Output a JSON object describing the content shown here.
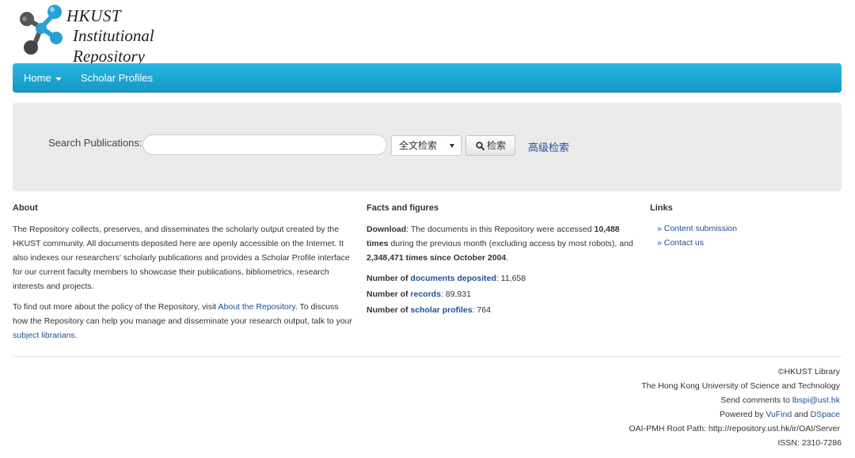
{
  "logo": {
    "line1": "HKUST",
    "line2": "Institutional Repository",
    "colors": {
      "dark": "#444444",
      "blue": "#2a9fd6"
    }
  },
  "nav": {
    "home_label": "Home",
    "scholar_label": "Scholar Profiles",
    "accent": "#1ea5d4"
  },
  "search": {
    "label": "Search Publications:",
    "input_value": "",
    "select_value": "全文检索",
    "button_label": "检索",
    "advanced_label": "高级检索"
  },
  "about": {
    "heading": "About",
    "p1": "The Repository collects, preserves, and disseminates the scholarly output created by the HKUST community. All documents deposited here are openly accessible on the Internet. It also indexes our researchers' scholarly publications and provides a Scholar Profile interface for our current faculty members to showcase their publications, bibliometrics, research interests and projects.",
    "p2_before": "To find out more about the policy of the Repository, visit ",
    "p2_link1": "About the Repository",
    "p2_mid": ". To discuss how the Repository can help you manage and disseminate your research output, talk to your ",
    "p2_link2": "subject librarians",
    "p2_end": "."
  },
  "facts": {
    "heading": "Facts and figures",
    "download_label": "Download",
    "download_text1": ": The documents in this Repository were accessed ",
    "times_month": "10,488 times",
    "download_text2": " during the previous month (excluding access by most robots), and ",
    "times_total": "2,348,471 times since October 2004",
    "download_end": ".",
    "numberof": "Number of",
    "docs_label": "documents deposited",
    "docs_value": ": 11,658",
    "records_label": "records",
    "records_value": ": 89,931",
    "profiles_label": "scholar profiles",
    "profiles_value": ": 764"
  },
  "links": {
    "heading": "Links",
    "items": [
      "» Content submission",
      "» Contact us"
    ]
  },
  "footer": {
    "copyright": "©HKUST Library",
    "university": "The Hong Kong University of Science and Technology",
    "comments_prefix": "Send comments to ",
    "email": "lbspi@ust.hk",
    "powered_prefix": "Powered by ",
    "vufind": "VuFind",
    "and": " and ",
    "dspace": "DSpace",
    "oai": "OAI-PMH Root Path: http://repository.ust.hk/ir/OAI/Server",
    "issn": "ISSN: 2310-7286"
  }
}
